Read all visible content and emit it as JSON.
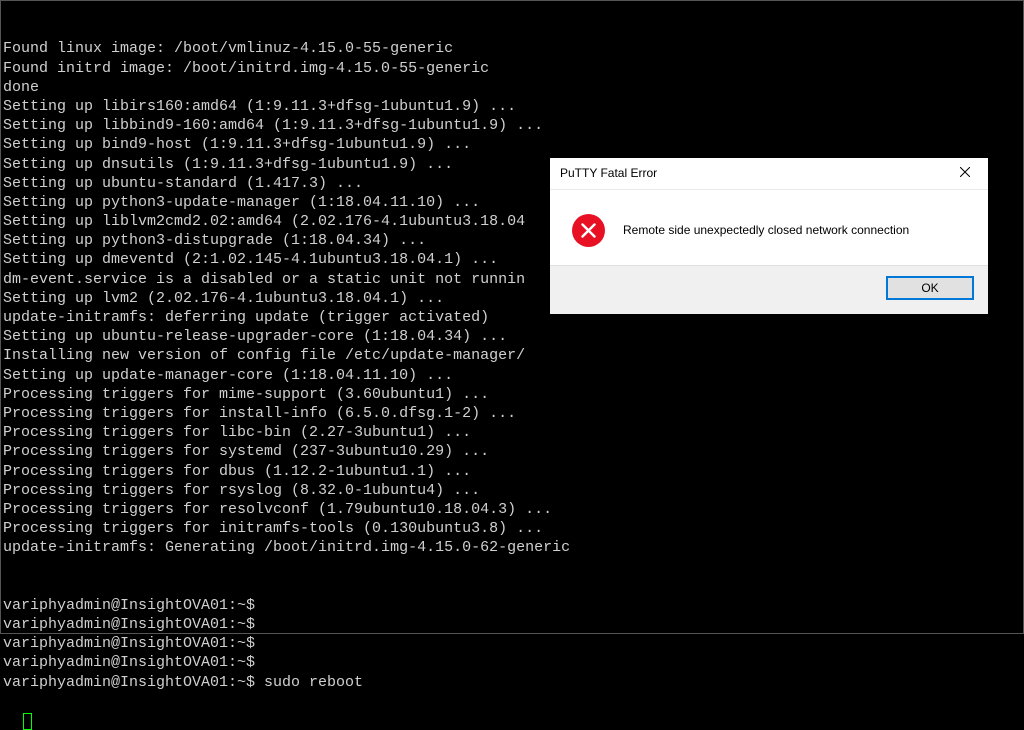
{
  "terminal": {
    "lines": [
      "Found linux image: /boot/vmlinuz-4.15.0-55-generic",
      "Found initrd image: /boot/initrd.img-4.15.0-55-generic",
      "done",
      "Setting up libirs160:amd64 (1:9.11.3+dfsg-1ubuntu1.9) ...",
      "Setting up libbind9-160:amd64 (1:9.11.3+dfsg-1ubuntu1.9) ...",
      "Setting up bind9-host (1:9.11.3+dfsg-1ubuntu1.9) ...",
      "Setting up dnsutils (1:9.11.3+dfsg-1ubuntu1.9) ...",
      "Setting up ubuntu-standard (1.417.3) ...",
      "Setting up python3-update-manager (1:18.04.11.10) ...",
      "Setting up liblvm2cmd2.02:amd64 (2.02.176-4.1ubuntu3.18.04",
      "Setting up python3-distupgrade (1:18.04.34) ...",
      "Setting up dmeventd (2:1.02.145-4.1ubuntu3.18.04.1) ...",
      "dm-event.service is a disabled or a static unit not runnin",
      "Setting up lvm2 (2.02.176-4.1ubuntu3.18.04.1) ...",
      "update-initramfs: deferring update (trigger activated)",
      "Setting up ubuntu-release-upgrader-core (1:18.04.34) ...",
      "Installing new version of config file /etc/update-manager/",
      "Setting up update-manager-core (1:18.04.11.10) ...",
      "Processing triggers for mime-support (3.60ubuntu1) ...",
      "Processing triggers for install-info (6.5.0.dfsg.1-2) ...",
      "Processing triggers for libc-bin (2.27-3ubuntu1) ...",
      "Processing triggers for systemd (237-3ubuntu10.29) ...",
      "Processing triggers for dbus (1.12.2-1ubuntu1.1) ...",
      "Processing triggers for rsyslog (8.32.0-1ubuntu4) ...",
      "Processing triggers for resolvconf (1.79ubuntu10.18.04.3) ...",
      "Processing triggers for initramfs-tools (0.130ubuntu3.8) ...",
      "update-initramfs: Generating /boot/initrd.img-4.15.0-62-generic"
    ],
    "prompts": [
      {
        "prompt": "variphyadmin@InsightOVA01:~$",
        "cmd": ""
      },
      {
        "prompt": "variphyadmin@InsightOVA01:~$",
        "cmd": ""
      },
      {
        "prompt": "variphyadmin@InsightOVA01:~$",
        "cmd": ""
      },
      {
        "prompt": "variphyadmin@InsightOVA01:~$",
        "cmd": ""
      },
      {
        "prompt": "variphyadmin@InsightOVA01:~$",
        "cmd": "sudo reboot"
      }
    ]
  },
  "dialog": {
    "title": "PuTTY Fatal Error",
    "message": "Remote side unexpectedly closed network connection",
    "ok_label": "OK"
  }
}
